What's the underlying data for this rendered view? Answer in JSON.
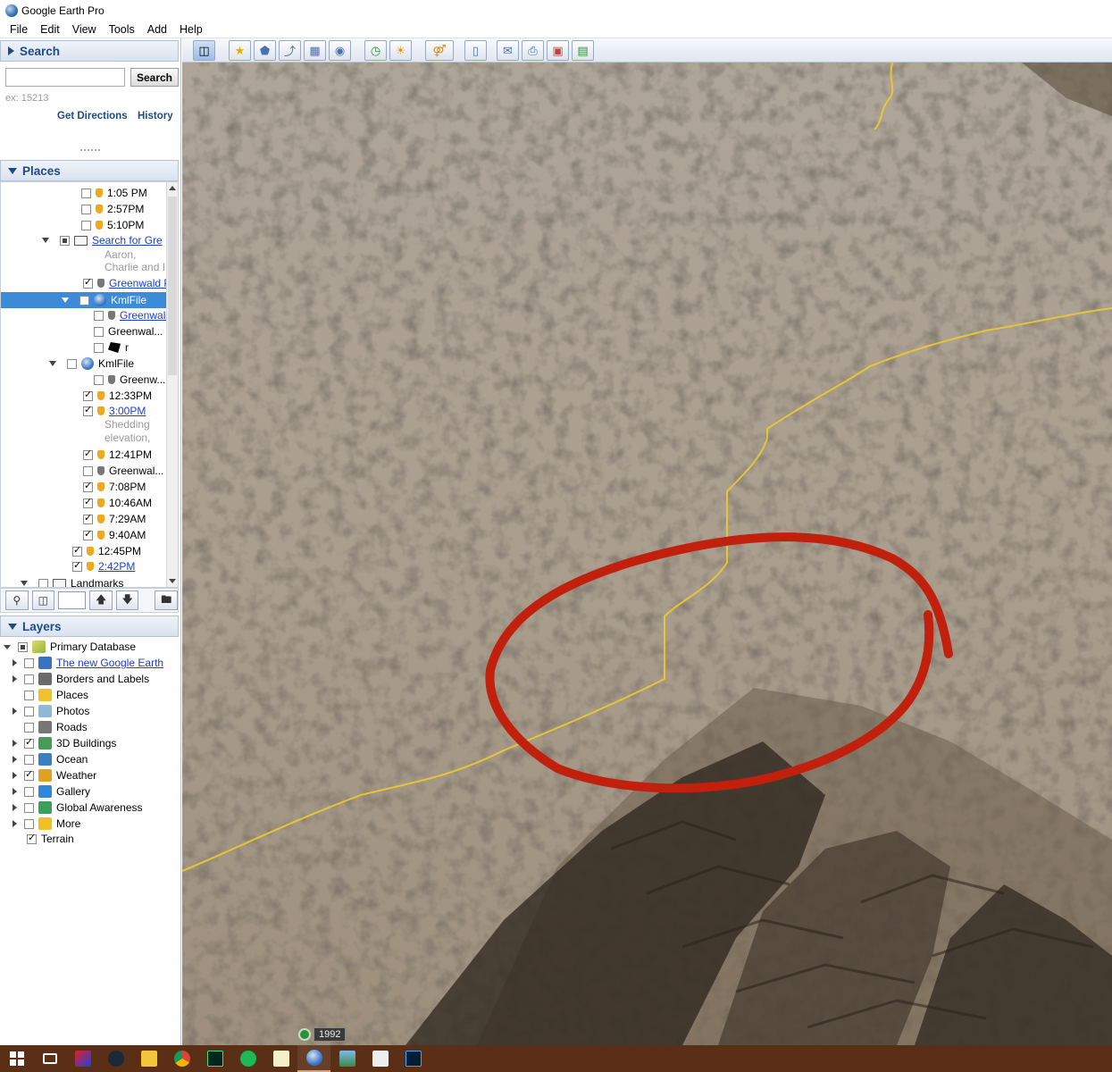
{
  "window": {
    "title": "Google Earth Pro"
  },
  "menu": [
    "File",
    "Edit",
    "View",
    "Tools",
    "Add",
    "Help"
  ],
  "search": {
    "header": "Search",
    "input_value": "",
    "button": "Search",
    "hint": "ex: 15213",
    "get_directions": "Get Directions",
    "history": "History"
  },
  "places": {
    "header": "Places",
    "rows": [
      {
        "label": "1:05 PM",
        "checked": false,
        "icon": "placemark"
      },
      {
        "label": "2:57PM",
        "checked": false,
        "icon": "placemark"
      },
      {
        "label": "5:10PM",
        "checked": false,
        "icon": "placemark"
      },
      {
        "label": "Search for Gre",
        "checked": "partial",
        "icon": "folder",
        "link": true
      },
      {
        "label": "Aaron,",
        "note": true
      },
      {
        "label": "Charlie and I",
        "note": true
      },
      {
        "label": "Greenwald P",
        "checked": true,
        "icon": "placemark-grey",
        "link": true
      },
      {
        "label": "KmlFile",
        "checked": false,
        "icon": "kml",
        "selected": true
      },
      {
        "label": "Greenwald",
        "checked": false,
        "icon": "placemark-grey",
        "link": true
      },
      {
        "label": "Greenwal...",
        "checked": false,
        "icon": "none"
      },
      {
        "label": "r",
        "checked": false,
        "icon": "polygon"
      },
      {
        "label": "KmlFile",
        "checked": false,
        "icon": "kml"
      },
      {
        "label": "Greenw...",
        "checked": false,
        "icon": "placemark-grey"
      },
      {
        "label": "12:33PM",
        "checked": true,
        "icon": "placemark"
      },
      {
        "label": "3:00PM",
        "checked": true,
        "icon": "placemark",
        "link": true
      },
      {
        "label": "Shedding",
        "note": true
      },
      {
        "label": "elevation,",
        "note": true
      },
      {
        "label": "12:41PM",
        "checked": true,
        "icon": "placemark"
      },
      {
        "label": "Greenwal...",
        "checked": false,
        "icon": "placemark-grey"
      },
      {
        "label": "7:08PM",
        "checked": true,
        "icon": "placemark"
      },
      {
        "label": "10:46AM",
        "checked": true,
        "icon": "placemark"
      },
      {
        "label": "7:29AM",
        "checked": true,
        "icon": "placemark"
      },
      {
        "label": "9:40AM",
        "checked": true,
        "icon": "placemark"
      },
      {
        "label": "12:45PM",
        "checked": true,
        "icon": "placemark"
      },
      {
        "label": "2:42PM",
        "checked": true,
        "icon": "placemark",
        "link": true
      },
      {
        "label": "Landmarks",
        "checked": false,
        "icon": "folder"
      }
    ]
  },
  "layers": {
    "header": "Layers",
    "primary": "Primary Database",
    "items": [
      {
        "label": "The new Google Earth",
        "checked": false,
        "link": true,
        "color": "#3a72c2"
      },
      {
        "label": "Borders and Labels",
        "checked": false,
        "color": "#6a6a6a"
      },
      {
        "label": "Places",
        "checked": false,
        "color": "#f2c12e"
      },
      {
        "label": "Photos",
        "checked": false,
        "color": "#8fb8d8"
      },
      {
        "label": "Roads",
        "checked": false,
        "color": "#777777"
      },
      {
        "label": "3D Buildings",
        "checked": true,
        "color": "#4a9a5a"
      },
      {
        "label": "Ocean",
        "checked": false,
        "color": "#3a7fc2"
      },
      {
        "label": "Weather",
        "checked": true,
        "color": "#e0a020"
      },
      {
        "label": "Gallery",
        "checked": false,
        "color": "#2f88d8"
      },
      {
        "label": "Global Awareness",
        "checked": false,
        "color": "#3aa05a"
      },
      {
        "label": "More",
        "checked": false,
        "color": "#f0c020"
      }
    ],
    "terrain": "Terrain"
  },
  "map": {
    "year": "1992"
  },
  "colors": {
    "accent": "#1f4a86",
    "selection": "#3d8ad8",
    "annotation": "#c0200c",
    "trail": "#e8c832",
    "taskbar": "#5a2f16"
  }
}
